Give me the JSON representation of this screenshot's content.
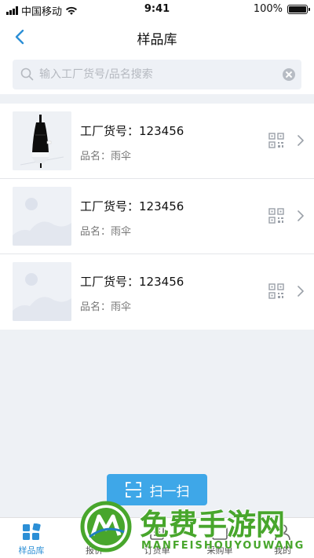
{
  "status": {
    "carrier": "中国移动",
    "time": "9:41",
    "battery": "100%"
  },
  "nav": {
    "title": "样品库"
  },
  "search": {
    "placeholder": "输入工厂货号/品名搜索",
    "value": ""
  },
  "products": [
    {
      "code_label": "工厂货号：",
      "code": "123456",
      "name_label": "品名：",
      "name": "雨伞",
      "image": "umbrella-photo"
    },
    {
      "code_label": "工厂货号：",
      "code": "123456",
      "name_label": "品名：",
      "name": "雨伞",
      "image": "image-placeholder"
    },
    {
      "code_label": "工厂货号：",
      "code": "123456",
      "name_label": "品名：",
      "name": "雨伞",
      "image": "image-placeholder"
    }
  ],
  "scan_button": {
    "label": "扫一扫"
  },
  "tabs": [
    {
      "label": "样品库",
      "icon": "grid-icon",
      "active": true
    },
    {
      "label": "报价",
      "icon": "quote-icon",
      "active": false
    },
    {
      "label": "订货单",
      "icon": "order-icon",
      "active": false
    },
    {
      "label": "采购单",
      "icon": "purchase-icon",
      "active": false
    },
    {
      "label": "我的",
      "icon": "user-icon",
      "active": false
    }
  ],
  "watermark": {
    "text": "免费手游网",
    "subtext": "MANFEISHOUYOUWANG"
  },
  "colors": {
    "accent": "#2c8fd6",
    "scan_button": "#3ea7e8",
    "watermark": "#48a62c"
  }
}
